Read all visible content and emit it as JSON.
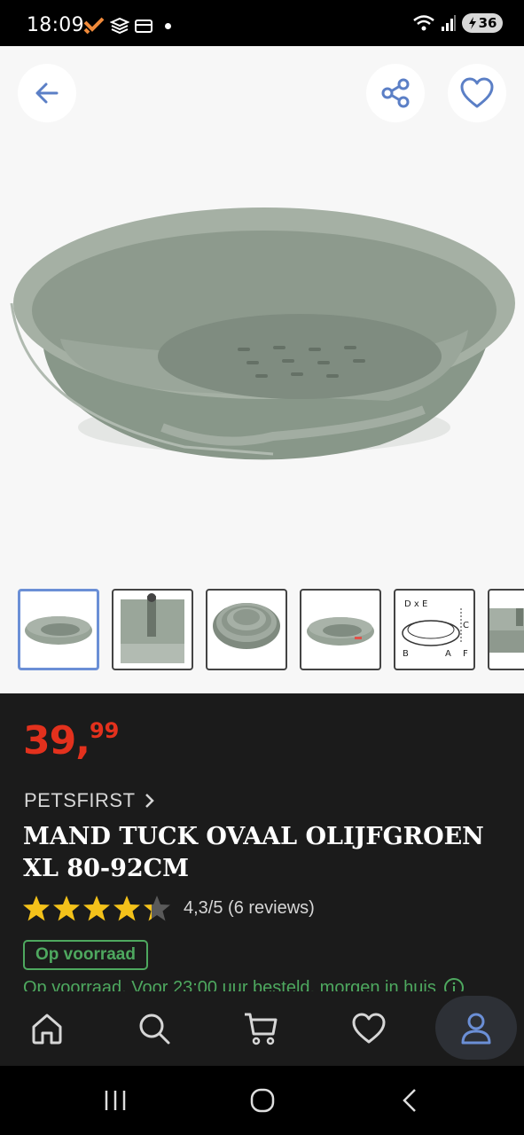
{
  "status_bar": {
    "time": "18:09",
    "battery": "36"
  },
  "gallery": {
    "back_icon": "arrow-left-icon",
    "share_icon": "share-icon",
    "favorite_icon": "heart-icon",
    "thumbnails": [
      {
        "label": "",
        "active": true
      },
      {
        "label": "",
        "active": false
      },
      {
        "label": "",
        "active": false
      },
      {
        "label": "",
        "active": false
      },
      {
        "label": "D x E",
        "active": false
      },
      {
        "label": "",
        "active": false
      }
    ],
    "diagram_labels": {
      "de": "D x E",
      "a": "A",
      "b": "B",
      "c": "C",
      "f": "F"
    }
  },
  "product": {
    "price_main": "39,",
    "price_cents": "99",
    "brand": "PETSFIRST",
    "title": "MAND TUCK OVAAL OLIJFGROEN XL 80-92CM",
    "rating_value": 4.3,
    "rating_text": "4,3/5 (6 reviews)",
    "stock_badge": "Op voorraad",
    "delivery_text": "Op voorraad. Voor 23:00 uur besteld, morgen in huis"
  },
  "bottom_nav": {
    "items": [
      "home-icon",
      "search-icon",
      "cart-icon",
      "heart-icon",
      "account-icon"
    ],
    "active": "account-icon"
  },
  "colors": {
    "price": "#e3311d",
    "accent_blue": "#6b8fd6",
    "stock_green": "#4ea85f",
    "panel": "#1b1b1b"
  }
}
